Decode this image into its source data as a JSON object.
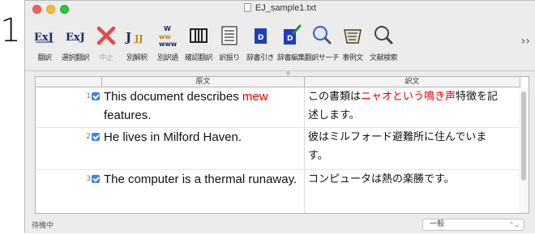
{
  "step_number": "1",
  "window": {
    "title": "EJ_sample1.txt"
  },
  "toolbar": {
    "items": [
      {
        "label": "翻訳",
        "icon": "translate-icon"
      },
      {
        "label": "選択翻訳",
        "icon": "selection-translate-icon"
      },
      {
        "label": "中止",
        "icon": "stop-icon"
      },
      {
        "label": "別解釈",
        "icon": "alternative-interpretation-icon"
      },
      {
        "label": "別訳語",
        "icon": "alternative-term-icon"
      },
      {
        "label": "確認翻訳",
        "icon": "confirm-translate-icon"
      },
      {
        "label": "訳振り",
        "icon": "interlinear-icon"
      },
      {
        "label": "辞書引き",
        "icon": "dictionary-lookup-icon"
      },
      {
        "label": "辞書編集",
        "icon": "dictionary-edit-icon"
      },
      {
        "label": "翻訳サーチ",
        "icon": "translation-search-icon"
      },
      {
        "label": "事例文",
        "icon": "example-sentence-icon"
      },
      {
        "label": "文献検索",
        "icon": "literature-search-icon"
      }
    ],
    "overflow": "››"
  },
  "grid": {
    "headers": {
      "source": "原文",
      "target": "訳文"
    },
    "rows": [
      {
        "number": "1",
        "source_pre": "This document describes ",
        "source_red": "mew",
        "source_post": " features.",
        "target_pre": "この書類は",
        "target_red": "ニャオという鳴き声",
        "target_post": "特徴を記述します。"
      },
      {
        "number": "2",
        "source_pre": "He lives in Milford Haven.",
        "source_red": "",
        "source_post": "",
        "target_pre": "彼はミルフォード避難所に住んでいます。",
        "target_red": "",
        "target_post": ""
      },
      {
        "number": "3",
        "source_pre": "The computer is a thermal runaway.",
        "source_red": "",
        "source_post": "",
        "target_pre": "コンピュータは熱の楽勝です。",
        "target_red": "",
        "target_post": ""
      }
    ]
  },
  "status": {
    "text": "待機中",
    "mode_select": "一般"
  },
  "colors": {
    "accent": "#3d84e6",
    "highlight": "#e60000"
  }
}
